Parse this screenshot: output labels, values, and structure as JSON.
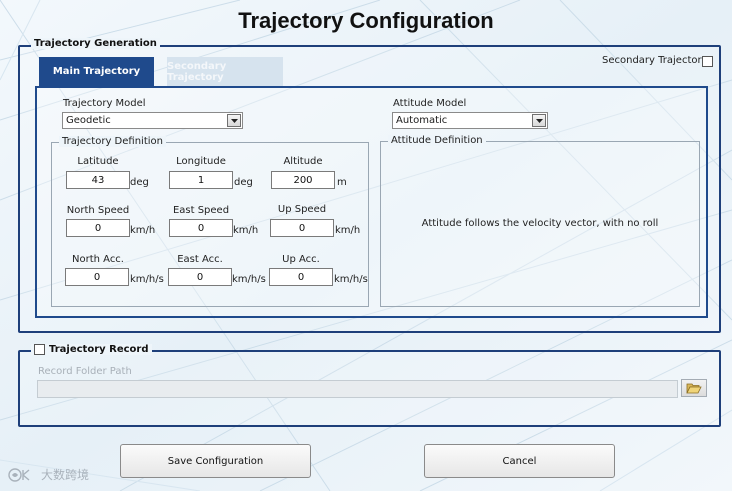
{
  "window": {
    "title": "Trajectory Configuration"
  },
  "trajectory_generation": {
    "legend": "Trajectory Generation",
    "secondary_checkbox_label": "Secondary Trajectory?",
    "secondary_checked": false,
    "tabs": [
      {
        "label": "Main Trajectory",
        "active": true
      },
      {
        "label": "Secondary Trajectory",
        "active": false
      }
    ],
    "trajectory_model": {
      "label": "Trajectory Model",
      "value": "Geodetic"
    },
    "attitude_model": {
      "label": "Attitude Model",
      "value": "Automatic"
    },
    "trajectory_definition": {
      "legend": "Trajectory Definition",
      "latitude": {
        "label": "Latitude",
        "value": "43",
        "unit": "deg"
      },
      "longitude": {
        "label": "Longitude",
        "value": "1",
        "unit": "deg"
      },
      "altitude": {
        "label": "Altitude",
        "value": "200",
        "unit": "m"
      },
      "north_speed": {
        "label": "North Speed",
        "value": "0",
        "unit": "km/h"
      },
      "east_speed": {
        "label": "East Speed",
        "value": "0",
        "unit": "km/h"
      },
      "up_speed": {
        "label": "Up Speed",
        "value": "0",
        "unit": "km/h"
      },
      "north_acc": {
        "label": "North Acc.",
        "value": "0",
        "unit": "km/h/s"
      },
      "east_acc": {
        "label": "East Acc.",
        "value": "0",
        "unit": "km/h/s"
      },
      "up_acc": {
        "label": "Up Acc.",
        "value": "0",
        "unit": "km/h/s"
      }
    },
    "attitude_definition": {
      "legend": "Attitude Definition",
      "message": "Attitude follows the velocity vector, with no roll"
    }
  },
  "trajectory_record": {
    "legend": "Trajectory Record",
    "checked": false,
    "folder_label": "Record Folder Path",
    "folder_value": ""
  },
  "buttons": {
    "save": "Save Configuration",
    "cancel": "Cancel"
  },
  "watermark": "大数跨境",
  "icons": {
    "dropdown": "chevron-down-icon",
    "folder": "folder-open-icon",
    "watermark_logo": "logo-icon"
  },
  "colors": {
    "accent": "#1f4a8c",
    "group_border": "#1e3f7a",
    "tab_inactive": "#d6e3ee",
    "background": "#eef5fa"
  }
}
